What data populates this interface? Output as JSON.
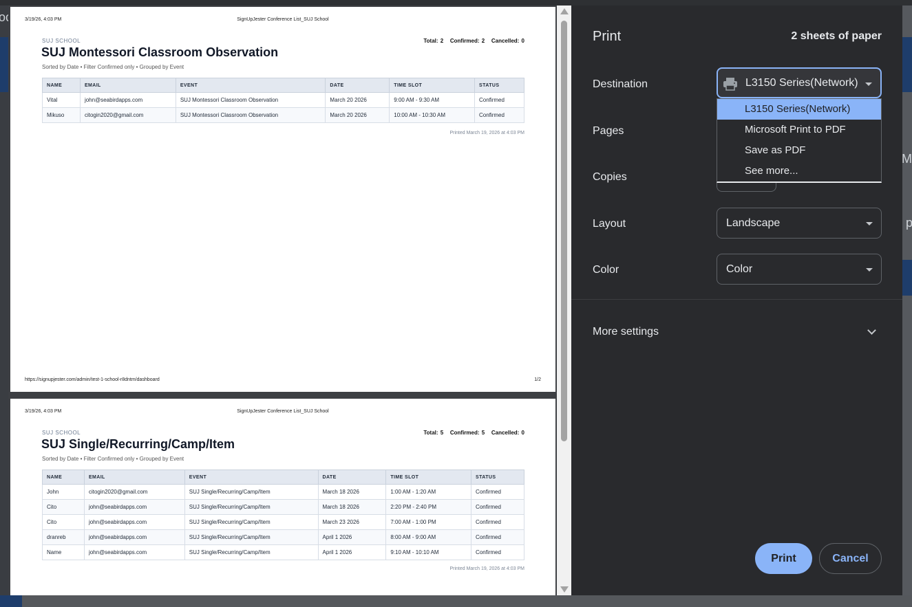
{
  "backdrop": {
    "left_text": "oc",
    "right_text_1": "Mo",
    "right_text_2": "p"
  },
  "preview": {
    "pages": [
      {
        "header_date": "3/19/26, 4:03 PM",
        "header_title": "SignUpJester Conference List_SUJ School",
        "school": "SUJ SCHOOL",
        "totals": "Total: 2   Confirmed: 2   Cancelled: 0",
        "title": "SUJ Montessori Classroom Observation",
        "subinfo": "Sorted by Date • Filter Confirmed only • Grouped by Event",
        "columns": [
          "NAME",
          "EMAIL",
          "EVENT",
          "DATE",
          "TIME SLOT",
          "STATUS"
        ],
        "rows": [
          [
            "Vital",
            "john@seabirdapps.com",
            "SUJ Montessori Classroom Observation",
            "March 20 2026",
            "9:00 AM - 9:30 AM",
            "Confirmed"
          ],
          [
            "Mikuso",
            "citogin2020@gmail.com",
            "SUJ Montessori Classroom Observation",
            "March 20 2026",
            "10:00 AM - 10:30 AM",
            "Confirmed"
          ]
        ],
        "printed": "Printed March 19, 2026 at 4:03 PM",
        "footer_url": "https://signupjester.com/admin/test-1-school-r8dntm/dashboard",
        "footer_page": "1/2"
      },
      {
        "header_date": "3/19/26, 4:03 PM",
        "header_title": "SignUpJester Conference List_SUJ School",
        "school": "SUJ SCHOOL",
        "totals": "Total: 5   Confirmed: 5   Cancelled: 0",
        "title": "SUJ Single/Recurring/Camp/Item",
        "subinfo": "Sorted by Date • Filter Confirmed only • Grouped by Event",
        "columns": [
          "NAME",
          "EMAIL",
          "EVENT",
          "DATE",
          "TIME SLOT",
          "STATUS"
        ],
        "rows": [
          [
            "John",
            "citogin2020@gmail.com",
            "SUJ Single/Recurring/Camp/Item",
            "March 18 2026",
            "1:00 AM - 1:20 AM",
            "Confirmed"
          ],
          [
            "Cito",
            "john@seabirdapps.com",
            "SUJ Single/Recurring/Camp/Item",
            "March 18 2026",
            "2:20 PM - 2:40 PM",
            "Confirmed"
          ],
          [
            "Cito",
            "john@seabirdapps.com",
            "SUJ Single/Recurring/Camp/Item",
            "March 23 2026",
            "7:00 AM - 1:00 PM",
            "Confirmed"
          ],
          [
            "dranreb",
            "john@seabirdapps.com",
            "SUJ Single/Recurring/Camp/Item",
            "April 1 2026",
            "8:00 AM - 9:00 AM",
            "Confirmed"
          ],
          [
            "Name",
            "john@seabirdapps.com",
            "SUJ Single/Recurring/Camp/Item",
            "April 1 2026",
            "9:10 AM - 10:10 AM",
            "Confirmed"
          ]
        ],
        "printed": "Printed March 19, 2026 at 4:03 PM"
      }
    ]
  },
  "panel": {
    "title": "Print",
    "sheets": "2 sheets of paper",
    "destination": {
      "label": "Destination",
      "value": "L3150 Series(Network)",
      "options": [
        "L3150 Series(Network)",
        "Microsoft Print to PDF",
        "Save as PDF",
        "See more..."
      ]
    },
    "pages_label": "Pages",
    "copies_label": "Copies",
    "layout": {
      "label": "Layout",
      "value": "Landscape"
    },
    "color": {
      "label": "Color",
      "value": "Color"
    },
    "more_settings": "More settings",
    "print_button": "Print",
    "cancel_button": "Cancel"
  },
  "colors": {
    "accent": "#8ab4f8",
    "panel_bg": "#292a2d",
    "selected_option": "#8ab4f8"
  }
}
